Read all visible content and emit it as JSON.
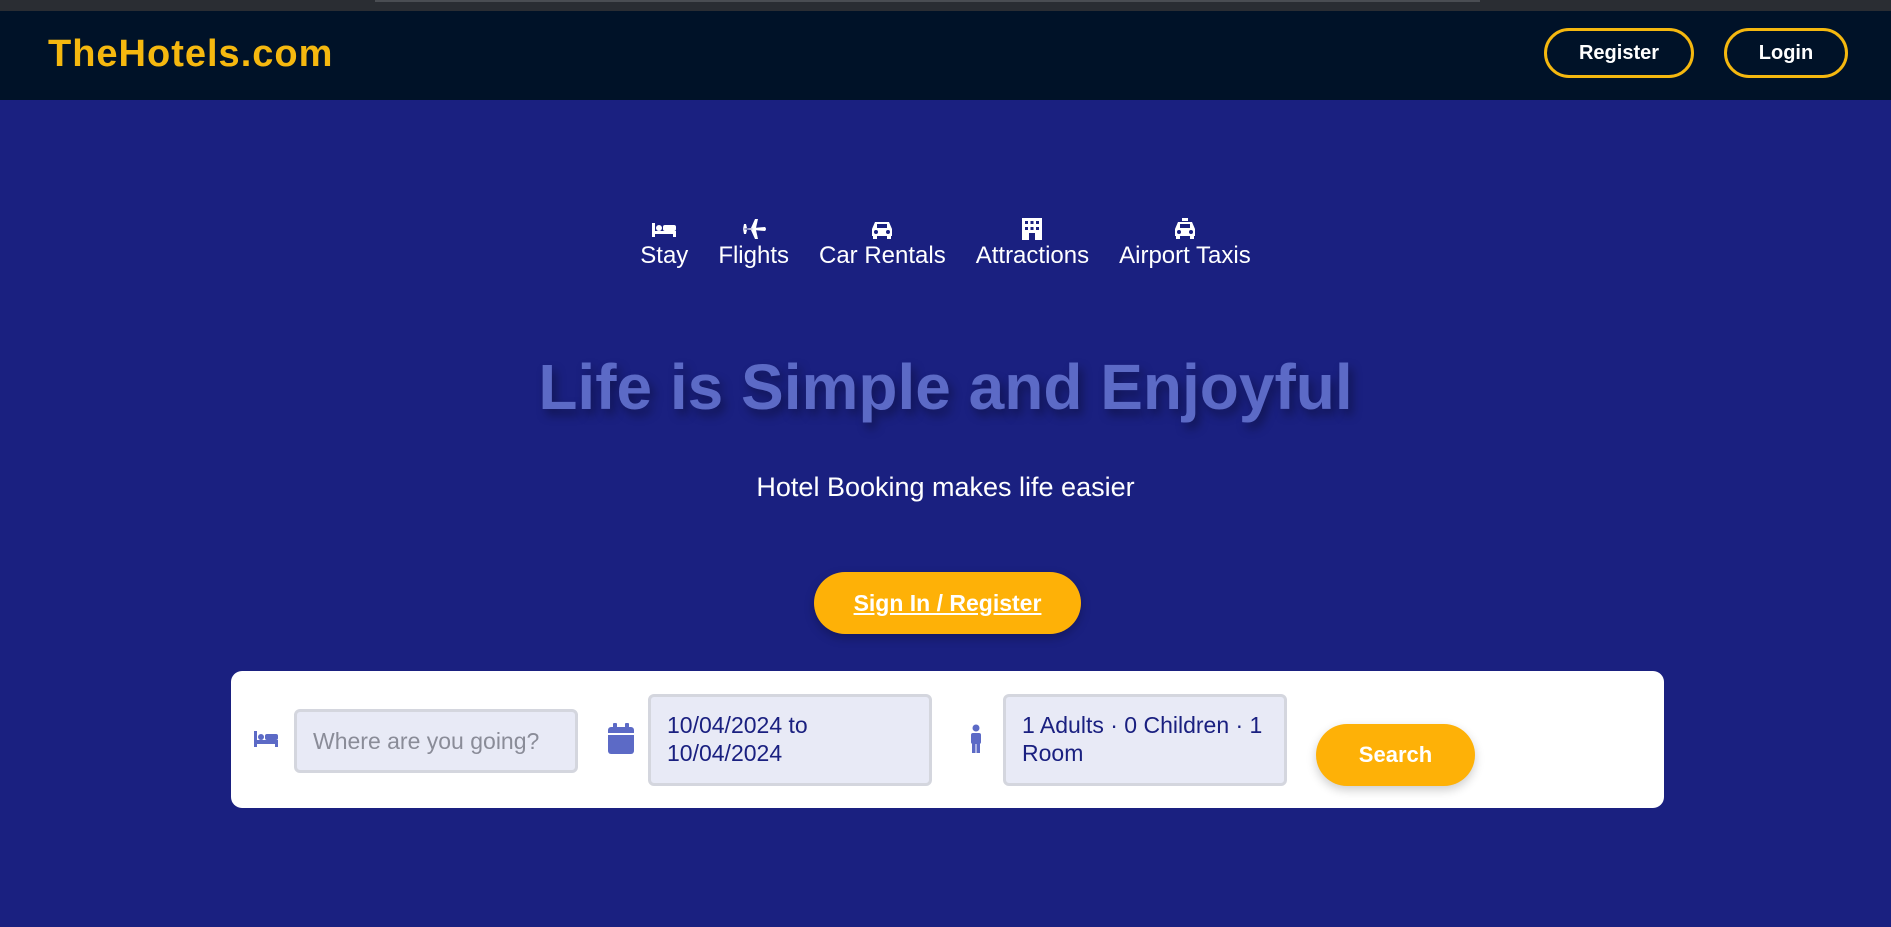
{
  "header": {
    "logo": "TheHotels.com",
    "register_label": "Register",
    "login_label": "Login"
  },
  "tabs": [
    {
      "label": "Stay",
      "icon": "bed-icon"
    },
    {
      "label": "Flights",
      "icon": "plane-icon"
    },
    {
      "label": "Car Rentals",
      "icon": "car-icon"
    },
    {
      "label": "Attractions",
      "icon": "building-icon"
    },
    {
      "label": "Airport Taxis",
      "icon": "taxi-icon"
    }
  ],
  "hero": {
    "title": "Life is Simple and Enjoyful",
    "subtitle": "Hotel Booking makes life easier",
    "cta_label": "Sign In / Register"
  },
  "search": {
    "destination_placeholder": "Where are you going?",
    "destination_icon": "bed-icon",
    "date_icon": "calendar-icon",
    "dates_value": "10/04/2024 to 10/04/2024",
    "guests_icon": "person-icon",
    "guests_value": "1 Adults · 0 Children · 1 Room",
    "search_label": "Search"
  },
  "colors": {
    "background": "#1a2080",
    "navbar": "#001228",
    "accent": "#feb107",
    "logo": "#f5b80f",
    "headline": "#5c6ac6",
    "field_bg": "#e8eaf6"
  }
}
